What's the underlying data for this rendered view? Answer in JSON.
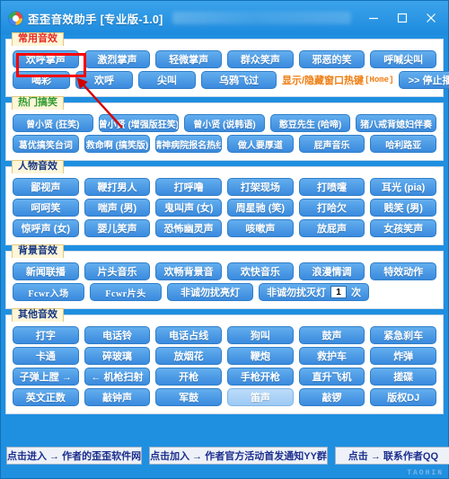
{
  "window": {
    "title": "歪歪音效助手 [专业版-1.0]",
    "logo_icon": "pinwheel-logo-icon",
    "minimize_label": "—",
    "maximize_label": "□",
    "close_label": "✕",
    "watermark": "TAOHIN"
  },
  "groups": [
    {
      "label": "常用音效",
      "label_color": "#e52a22",
      "rows": [
        {
          "buttons": [
            {
              "label": "欢呼掌声",
              "highlighted": true
            },
            {
              "label": "激烈掌声"
            },
            {
              "label": "轻微掌声"
            },
            {
              "label": "群众笑声"
            },
            {
              "label": "邪恶的笑"
            },
            {
              "label": "呼喊尖叫"
            }
          ]
        },
        {
          "buttons": [
            {
              "label": "喝彩"
            },
            {
              "label": "欢呼"
            },
            {
              "label": "尖叫"
            },
            {
              "label": "乌鸦飞过"
            }
          ],
          "hotkey_text": "显示/隐藏窗口热键",
          "hotkey_key": "[Home]",
          "stop_button": ">> 停止播放音效 <<"
        }
      ]
    },
    {
      "label": "热门搞笑",
      "label_color": "#2e9b2e",
      "rows": [
        {
          "buttons": [
            {
              "label": "曾小贤 (狂笑)"
            },
            {
              "label": "曾小贤 (增强版狂笑)"
            },
            {
              "label": "曾小贤 (说韩语)"
            },
            {
              "label": "憨豆先生 (哈啼)"
            },
            {
              "label": "猪八戒背媳妇伴奏"
            }
          ]
        },
        {
          "buttons": [
            {
              "label": "葛优搞笑台词"
            },
            {
              "label": "救命啊 (搞笑版)"
            },
            {
              "label": "精神病院报名热线"
            },
            {
              "label": "做人要厚道"
            },
            {
              "label": "屁声音乐"
            },
            {
              "label": "哈利路亚"
            }
          ]
        }
      ]
    },
    {
      "label": "人物音效",
      "label_color": "#16367f",
      "rows": [
        {
          "buttons": [
            {
              "label": "鄙视声"
            },
            {
              "label": "鞭打男人"
            },
            {
              "label": "打呼噜"
            },
            {
              "label": "打架现场"
            },
            {
              "label": "打喷嚏"
            },
            {
              "label": "耳光 (pia)"
            }
          ]
        },
        {
          "buttons": [
            {
              "label": "呵呵笑"
            },
            {
              "label": "喘声 (男)"
            },
            {
              "label": "鬼叫声 (女)"
            },
            {
              "label": "周星驰 (笑)"
            },
            {
              "label": "打哈欠"
            },
            {
              "label": "贱笑 (男)"
            }
          ]
        },
        {
          "buttons": [
            {
              "label": "惊呼声 (女)"
            },
            {
              "label": "婴儿笑声"
            },
            {
              "label": "恐怖幽灵声"
            },
            {
              "label": "咳嗽声"
            },
            {
              "label": "放屁声"
            },
            {
              "label": "女孩笑声"
            }
          ]
        }
      ]
    },
    {
      "label": "背景音效",
      "label_color": "#16367f",
      "rows": [
        {
          "buttons": [
            {
              "label": "新闻联播"
            },
            {
              "label": "片头音乐"
            },
            {
              "label": "欢畅背景音"
            },
            {
              "label": "欢快音乐"
            },
            {
              "label": "浪漫情调"
            },
            {
              "label": "特效动作"
            }
          ]
        },
        {
          "buttons": [
            {
              "label": "Fcwr入场",
              "latin": true
            },
            {
              "label": "Fcwr片头",
              "latin": true
            },
            {
              "label": "非诚勿扰亮灯"
            }
          ],
          "counter": {
            "prefix": "非诚勿扰灭灯",
            "value": "1",
            "suffix": "次"
          }
        }
      ]
    },
    {
      "label": "其他音效",
      "label_color": "#16367f",
      "rows": [
        {
          "buttons": [
            {
              "label": "打字"
            },
            {
              "label": "电话铃"
            },
            {
              "label": "电话占线"
            },
            {
              "label": "狗叫"
            },
            {
              "label": "鼓声"
            },
            {
              "label": "紧急刹车"
            }
          ]
        },
        {
          "buttons": [
            {
              "label": "卡通"
            },
            {
              "label": "碎玻璃"
            },
            {
              "label": "放烟花"
            },
            {
              "label": "鞭炮"
            },
            {
              "label": "救护车"
            },
            {
              "label": "炸弹"
            }
          ]
        },
        {
          "buttons": [
            {
              "label": "子弹上膛 →"
            },
            {
              "label": "← 机枪扫射"
            },
            {
              "label": "开枪"
            },
            {
              "label": "手枪开枪"
            },
            {
              "label": "直升飞机"
            },
            {
              "label": "搓碟"
            }
          ]
        },
        {
          "buttons": [
            {
              "label": "英文正数"
            },
            {
              "label": "敲钟声"
            },
            {
              "label": "军鼓"
            },
            {
              "label": "笛声",
              "hover": true
            },
            {
              "label": "敲锣"
            },
            {
              "label": "版权DJ"
            }
          ]
        }
      ]
    }
  ],
  "bottom_links": [
    {
      "label": "点击进入 → 作者的歪歪软件网"
    },
    {
      "label": "点击加入 → 作者官方活动首发通知YY群"
    },
    {
      "label": "点击 → 联系作者QQ"
    }
  ],
  "colors": {
    "window_bg": "#1f8fe0",
    "button_blue": "#3a8ade",
    "annotation_red": "#ff0000",
    "hotkey_orange": "#ef7d10"
  }
}
